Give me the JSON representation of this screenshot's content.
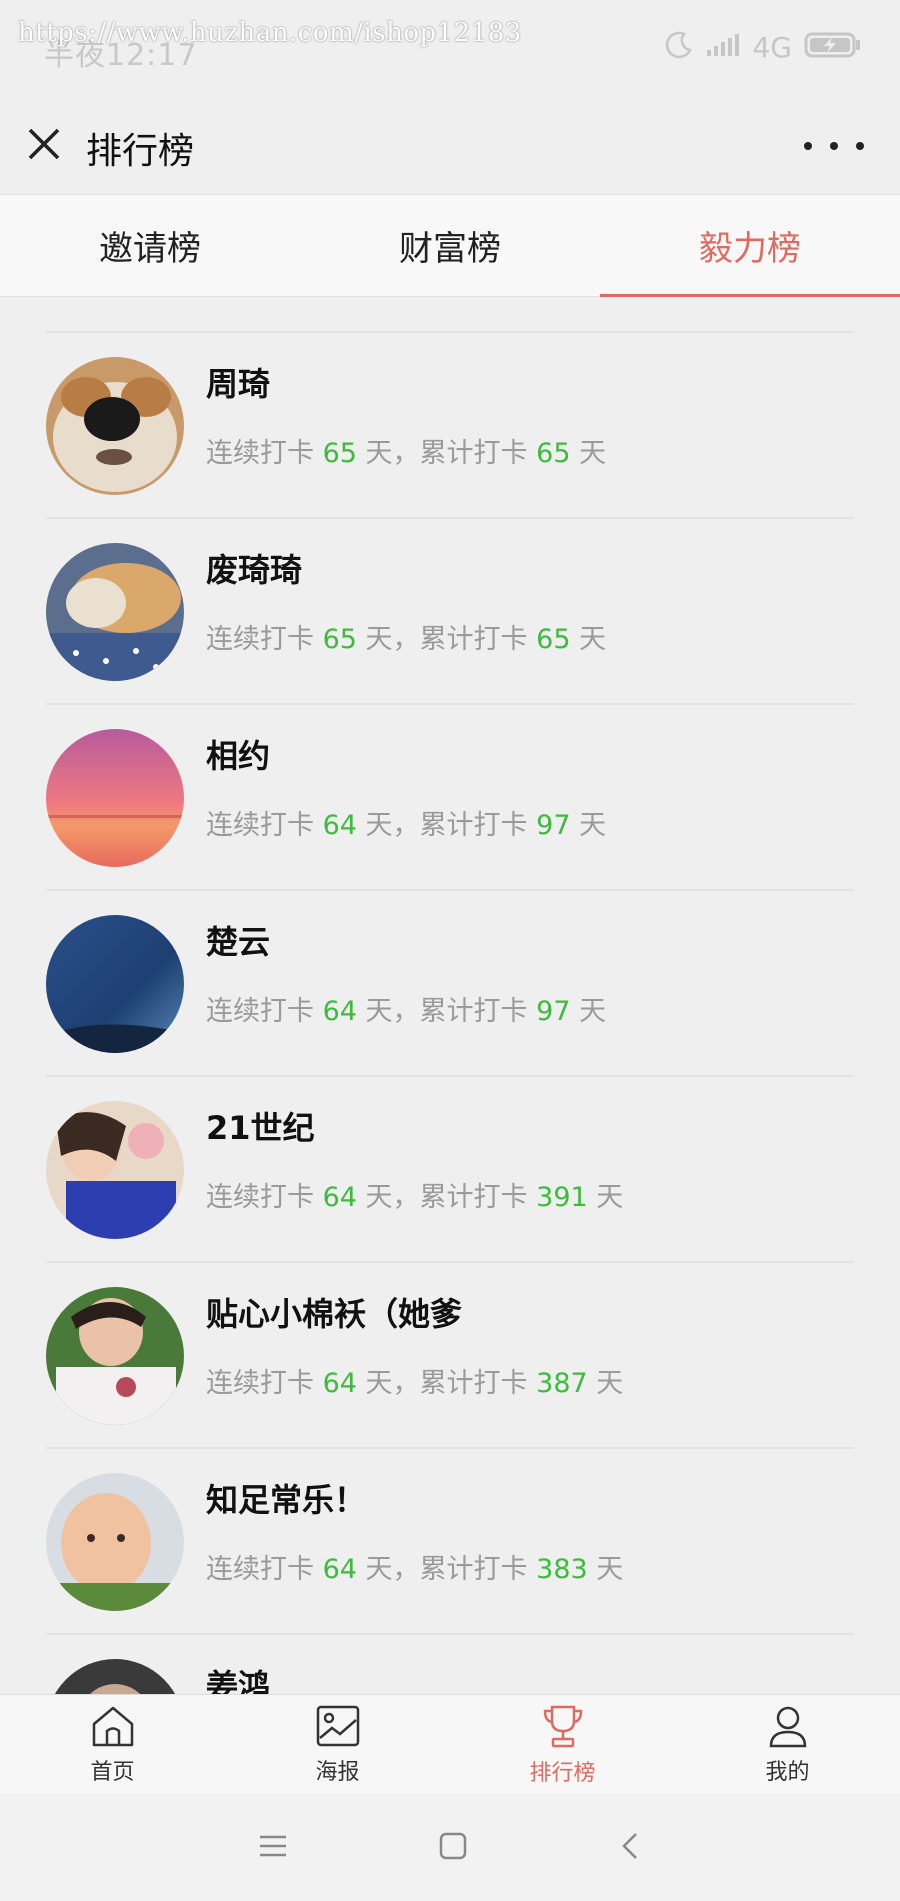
{
  "status_bar": {
    "time": "半夜12:17",
    "watermark": "https://www.huzhan.com/ishop12183",
    "network": "4G",
    "icons": [
      "moon-icon",
      "signal-icon",
      "battery-charging-icon"
    ]
  },
  "title_bar": {
    "title": "排行榜",
    "close_icon": "close-icon",
    "more_icon": "more-icon"
  },
  "tabs": [
    {
      "label": "邀请榜",
      "active": false
    },
    {
      "label": "财富榜",
      "active": false
    },
    {
      "label": "毅力榜",
      "active": true
    }
  ],
  "list": {
    "stat_prefix": "连续打卡",
    "stat_middle": "天，累计打卡",
    "stat_suffix": "天",
    "rows": [
      {
        "name": "周琦",
        "streak": "65",
        "total": "65"
      },
      {
        "name": "废琦琦",
        "streak": "65",
        "total": "65"
      },
      {
        "name": "相约",
        "streak": "64",
        "total": "97"
      },
      {
        "name": "楚云",
        "streak": "64",
        "total": "97"
      },
      {
        "name": "21世纪",
        "streak": "64",
        "total": "391"
      },
      {
        "name": "贴心小棉袄（她爹",
        "streak": "64",
        "total": "387"
      },
      {
        "name": "知足常乐！",
        "streak": "64",
        "total": "383"
      },
      {
        "name": "姜鸿",
        "streak": "",
        "total": ""
      }
    ]
  },
  "bottom_nav": [
    {
      "label": "首页",
      "icon": "home-icon",
      "active": false
    },
    {
      "label": "海报",
      "icon": "poster-icon",
      "active": false
    },
    {
      "label": "排行榜",
      "icon": "trophy-icon",
      "active": true
    },
    {
      "label": "我的",
      "icon": "user-icon",
      "active": false
    }
  ],
  "system_nav": [
    "menu-icon",
    "home-square-icon",
    "back-icon"
  ],
  "colors": {
    "accent": "#e06a5f",
    "stat_number": "#3dbb3d",
    "background": "#efefef"
  }
}
